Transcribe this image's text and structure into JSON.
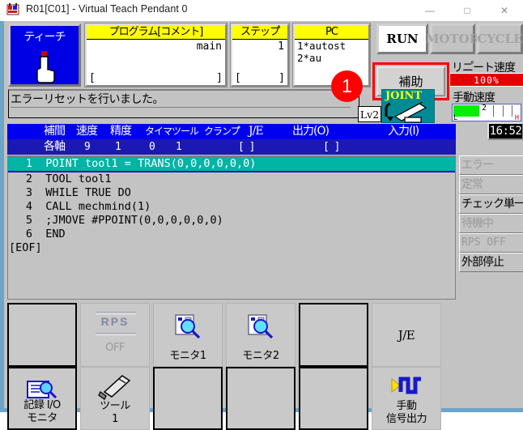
{
  "window": {
    "title": "R01[C01] - Virtual Teach Pendant 0",
    "icon": "app-icon",
    "minimize": "—",
    "maximize": "□",
    "close": "✕"
  },
  "top": {
    "teach": {
      "label": "ティーチ",
      "icon": "hand-pointer-icon"
    },
    "program": {
      "header": "プログラム[コメント]",
      "value": "main",
      "bracket_left": "[",
      "bracket_right": "]"
    },
    "step": {
      "header": "ステップ゚",
      "value": "1",
      "bracket_left": "[",
      "bracket_right": "]"
    },
    "pc": {
      "header": "PC",
      "line1": "1*autost",
      "line2": "2*au"
    },
    "lamps": [
      {
        "label": "RUN",
        "state": "on"
      },
      {
        "label": "MOTOR",
        "state": "off"
      },
      {
        "label": "CYCLE",
        "state": "off"
      }
    ],
    "aux_button": {
      "label": "補助",
      "highlight_color": "#ff0000"
    },
    "badge": {
      "text": "1",
      "color": "#ff0000"
    },
    "repeat_speed": {
      "label": "リニ゚ート速度",
      "value": "100%",
      "color": "#e40000"
    },
    "manual_speed": {
      "label": "手動速度",
      "value": "2",
      "low": "L",
      "high": "H",
      "fill_color": "#00f000"
    }
  },
  "message": {
    "text": "エラーリセットを行いました。",
    "level": "Lv2",
    "mode_icon": "joint-robot-icon",
    "mode_label": "JOINT"
  },
  "table": {
    "headers": [
      "補間",
      "速度",
      "精度",
      "タイマ",
      "ツール",
      "クランプ゚",
      "J/E",
      "出力(O)",
      "入力(I)"
    ],
    "row": {
      "interp": "各軸",
      "speed": "9",
      "accuracy": "1",
      "timer": "0",
      "tool": "1",
      "clamp": "",
      "je": "",
      "output": "[                ]",
      "input": "[                ]"
    }
  },
  "clock": {
    "time": "16:52"
  },
  "code": {
    "lines": [
      {
        "num": "1",
        "text": "POINT tool1 = TRANS(0,0,0,0,0,0)",
        "selected": true
      },
      {
        "num": "2",
        "text": "TOOL tool1",
        "selected": false
      },
      {
        "num": "3",
        "text": "WHILE TRUE DO",
        "selected": false
      },
      {
        "num": "4",
        "text": "CALL mechmind(1)",
        "selected": false
      },
      {
        "num": "5",
        "text": ";JMOVE #PPOINT(0,0,0,0,0,0)",
        "selected": false
      },
      {
        "num": "6",
        "text": "END",
        "selected": false
      }
    ],
    "eof": "[EOF]"
  },
  "status_stack": [
    {
      "label": "エラー",
      "active": false
    },
    {
      "label": "定常",
      "active": false
    },
    {
      "label": "チェック単一",
      "active": true
    },
    {
      "label": "待機中",
      "active": false
    },
    {
      "label": "RPS OFF",
      "active": false,
      "mono": true
    },
    {
      "label": "外部停止",
      "active": true
    }
  ],
  "function_grid": {
    "columns": [
      {
        "top": {
          "label": "",
          "icon": "",
          "style": "framed",
          "enabled": true
        },
        "bottom": {
          "label": "記録 I/O\nモニタ",
          "icon": "record-io-monitor-icon",
          "style": "framed",
          "enabled": true
        }
      },
      {
        "top": {
          "label": "OFF",
          "icon": "rps-icon",
          "style": "flat",
          "enabled": false,
          "extra": "RPS"
        },
        "bottom": {
          "label": "ツール\n1",
          "icon": "tool-icon",
          "style": "flat",
          "enabled": true
        }
      },
      {
        "top": {
          "label": "モニタ1",
          "icon": "monitor-magnifier-icon",
          "style": "flat",
          "enabled": true
        },
        "bottom": {
          "label": "",
          "icon": "",
          "style": "framed",
          "enabled": true
        }
      },
      {
        "top": {
          "label": "モニタ2",
          "icon": "monitor-magnifier-icon",
          "style": "flat",
          "enabled": true
        },
        "bottom": {
          "label": "",
          "icon": "",
          "style": "framed",
          "enabled": true
        }
      },
      {
        "top": {
          "label": "",
          "icon": "",
          "style": "framed",
          "enabled": true
        },
        "bottom": {
          "label": "",
          "icon": "",
          "style": "framed",
          "enabled": true
        }
      },
      {
        "top": {
          "label": "J/E",
          "icon": "",
          "style": "flat",
          "enabled": true
        },
        "bottom": {
          "label": "手動\n信号出力",
          "icon": "signal-output-icon",
          "style": "flat",
          "enabled": true
        }
      },
      {
        "top": {
          "label": "",
          "icon": "",
          "style": "none",
          "enabled": false
        },
        "bottom": {
          "label": "",
          "icon": "",
          "style": "none",
          "enabled": false
        }
      }
    ]
  }
}
